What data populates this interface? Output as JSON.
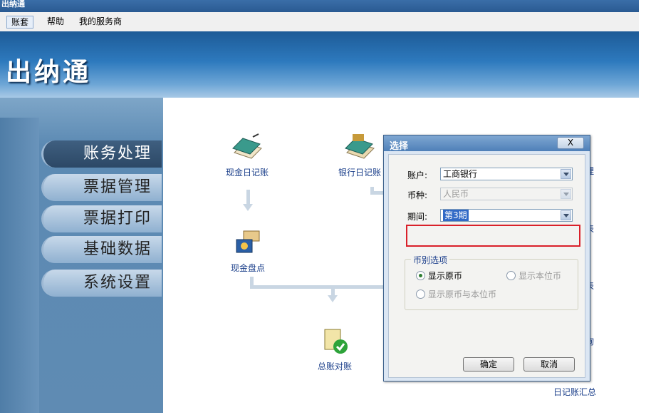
{
  "window": {
    "title": "出纳通"
  },
  "menu": {
    "items": [
      {
        "label": "账套",
        "active": true
      },
      {
        "label": "帮助"
      },
      {
        "label": "我的服务商"
      }
    ]
  },
  "banner": {
    "app_name": "出纳通"
  },
  "sidebar": {
    "items": [
      {
        "label": "账务处理",
        "selected": true
      },
      {
        "label": "票据管理"
      },
      {
        "label": "票据打印"
      },
      {
        "label": "基础数据"
      },
      {
        "label": "系统设置"
      }
    ]
  },
  "modules": {
    "cash_journal": "现金日记账",
    "bank_journal": "银行日记账",
    "cash_count": "现金盘点",
    "ledger_reconcile": "总账对账",
    "journal_summary": "日记账汇总",
    "partial_right_1": "理",
    "partial_right_2": "表",
    "partial_right_3": "表",
    "partial_right_4": "询"
  },
  "dialog": {
    "title": "选择",
    "close_label": "X",
    "account_label": "账户:",
    "account_value": "工商银行",
    "currency_label": "币种:",
    "currency_value": "人民币",
    "period_label": "期间:",
    "period_value": "第3期",
    "group_title": "币别选项",
    "radio_original": "显示原币",
    "radio_base": "显示本位币",
    "radio_both": "显示原币与本位币",
    "ok_label": "确定",
    "cancel_label": "取消"
  },
  "colors": {
    "highlight_border": "#d9202a",
    "selection": "#3169c6",
    "link_text": "#1a3e8a"
  }
}
